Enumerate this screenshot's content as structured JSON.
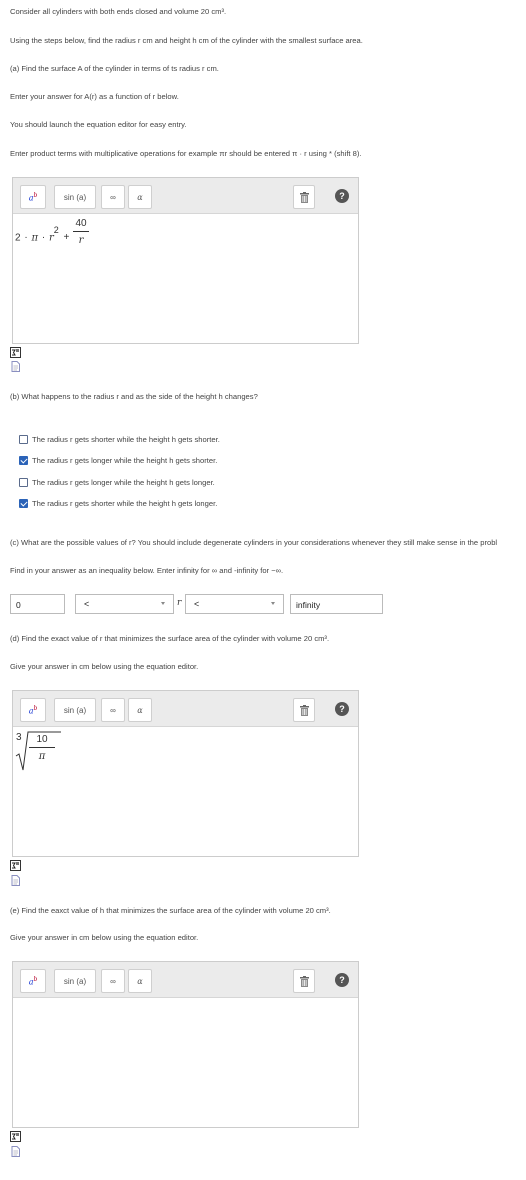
{
  "intro": {
    "line1": "Consider all cylinders with both ends closed and volume 20 cm³.",
    "line2": "Using the steps below, find the radius r cm and height h cm of the cylinder with the smallest surface area."
  },
  "part_a": {
    "question": "(a) Find the surface A of the cylinder in terms of ts radius r cm.",
    "instruction": "Enter your answer for A(r) as a function of r below.",
    "hint1": "You should launch the equation editor for easy entry.",
    "hint2": "Enter product terms with multiplicative operations for example πr should be entered π · r using * (shift 8).",
    "answer": {
      "coef": "2",
      "pi": "π",
      "r": "r",
      "exp": "2",
      "plus": "+",
      "num": "40",
      "den": "r"
    }
  },
  "toolbar": {
    "power_base": "a",
    "power_exp": "b",
    "sin_label": "sin (a)",
    "infinity_label": "∞",
    "alpha_label": "α",
    "help_label": "?"
  },
  "part_b": {
    "question": "(b) What happens to the radius r and as the side of the height h changes?",
    "options": [
      {
        "text": "The radius r gets shorter while the height h gets shorter.",
        "checked": false
      },
      {
        "text": "The radius r gets longer while the height h gets shorter.",
        "checked": true
      },
      {
        "text": "The radius r gets longer while the height h gets longer.",
        "checked": false
      },
      {
        "text": "The radius r gets shorter while the height h gets longer.",
        "checked": true
      }
    ]
  },
  "part_c": {
    "question": "(c) What are the possible values of r? You should include degenerate cylinders in your considerations whenever they still make sense in the probl",
    "instruction": "Find in your answer as an inequality below. Enter infinity for ∞ and -infinity for −∞.",
    "lower_value": "0",
    "op1": "<",
    "variable": "r",
    "op2": "<",
    "upper_value": "infinity"
  },
  "part_d": {
    "question": "(d) Find the exact value of r that minimizes the surface area of the cylinder with volume 20 cm³.",
    "instruction": "Give your answer in cm below using the equation editor.",
    "answer": {
      "index": "3",
      "num": "10",
      "den": "π"
    }
  },
  "part_e": {
    "question": "(e) Find the eaxct value of h that minimizes the surface area of the cylinder with volume 20 cm³.",
    "instruction": "Give your answer in cm below using the equation editor."
  },
  "colors": {
    "checkbox_checked": "#2b63b8",
    "power_base": "#1c3bd4",
    "power_exp": "#b5002a"
  },
  "icons": [
    "trash-icon",
    "help-icon",
    "math-editor-icon",
    "document-icon"
  ]
}
